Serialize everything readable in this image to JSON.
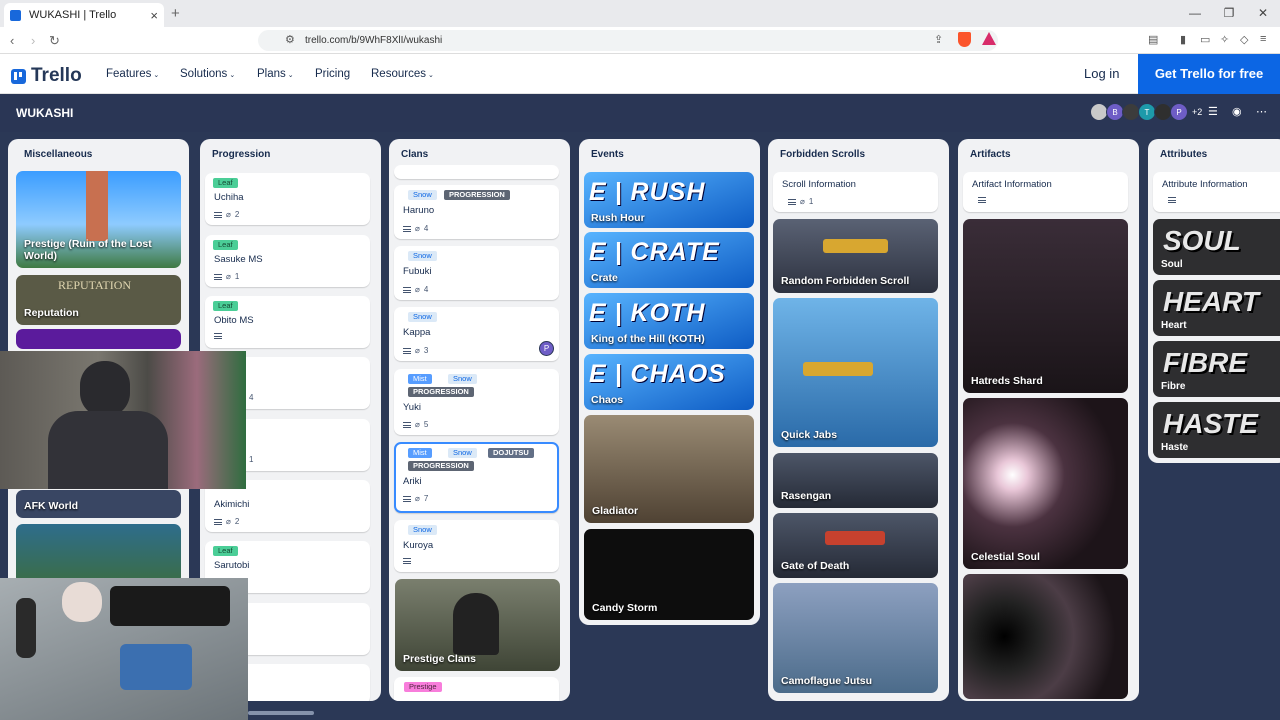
{
  "browser": {
    "tab_title": "WUKASHI | Trello",
    "url": "trello.com/b/9WhF8XlI/wukashi"
  },
  "nav": {
    "logo": "Trello",
    "items": [
      "Features",
      "Solutions",
      "Plans",
      "Pricing",
      "Resources"
    ],
    "login": "Log in",
    "cta": "Get Trello for free"
  },
  "board": {
    "title": "WUKASHI",
    "members": [
      "B",
      "T",
      "P"
    ],
    "more_members": "+2"
  },
  "lists": {
    "misc": {
      "title": "Miscellaneous",
      "cards": [
        "Prestige (Ruin of the Lost World)",
        "Reputation",
        "AFK World"
      ],
      "reputation_banner": "REPUTATION"
    },
    "progression": {
      "title": "Progression",
      "cards": [
        {
          "label": "Leaf",
          "title": "Uchiha",
          "count": "2"
        },
        {
          "label": "Leaf",
          "title": "Sasuke MS",
          "count": "1"
        },
        {
          "label": "Leaf",
          "title": "Obito MS",
          "count": ""
        },
        {
          "label": "",
          "title": "",
          "count": "4"
        },
        {
          "label": "",
          "title": "",
          "count": "1"
        },
        {
          "label": "",
          "title": "Akimichi",
          "count": "2"
        },
        {
          "label": "Leaf",
          "title": "Sarutobi",
          "count": ""
        }
      ]
    },
    "clans": {
      "title": "Clans",
      "cards": [
        {
          "labels": [
            "Snow",
            "PROGRESSION"
          ],
          "title": "Haruno",
          "count": "4"
        },
        {
          "labels": [
            "Snow"
          ],
          "title": "Fubuki",
          "count": "4"
        },
        {
          "labels": [
            "Snow"
          ],
          "title": "Kappa",
          "count": "3",
          "member": "P"
        },
        {
          "labels": [
            "Mist",
            "Snow",
            "PROGRESSION"
          ],
          "title": "Yuki",
          "count": "5"
        },
        {
          "labels": [
            "Mist",
            "Snow",
            "DOJUTSU",
            "PROGRESSION"
          ],
          "title": "Ariki",
          "count": "7"
        },
        {
          "labels": [
            "Snow"
          ],
          "title": "Kuroya",
          "count": ""
        }
      ],
      "prestige_card": "Prestige Clans",
      "prestige_label": "Prestige"
    },
    "events": {
      "title": "Events",
      "cards": [
        {
          "banner": "E | RUSH",
          "caption": "Rush Hour"
        },
        {
          "banner": "E | CRATE",
          "caption": "Crate"
        },
        {
          "banner": "E | KOTH",
          "caption": "King of the Hill (KOTH)"
        },
        {
          "banner": "E | CHAOS",
          "caption": "Chaos"
        }
      ],
      "image_cards": [
        "Gladiator",
        "Candy Storm"
      ]
    },
    "scrolls": {
      "title": "Forbidden Scrolls",
      "info": "Scroll Information",
      "info_count": "1",
      "cards": [
        "Random Forbidden Scroll",
        "Quick Jabs",
        "Rasengan",
        "Gate of Death",
        "Camoflague Jutsu"
      ]
    },
    "artifacts": {
      "title": "Artifacts",
      "info": "Artifact Information",
      "cards": [
        "Hatreds Shard",
        "Celestial Soul"
      ]
    },
    "attributes": {
      "title": "Attributes",
      "info": "Attribute Information",
      "cards": [
        {
          "banner": "SOUL",
          "caption": "Soul"
        },
        {
          "banner": "HEART",
          "caption": "Heart"
        },
        {
          "banner": "FIBRE",
          "caption": "Fibre"
        },
        {
          "banner": "HASTE",
          "caption": "Haste"
        }
      ]
    }
  }
}
